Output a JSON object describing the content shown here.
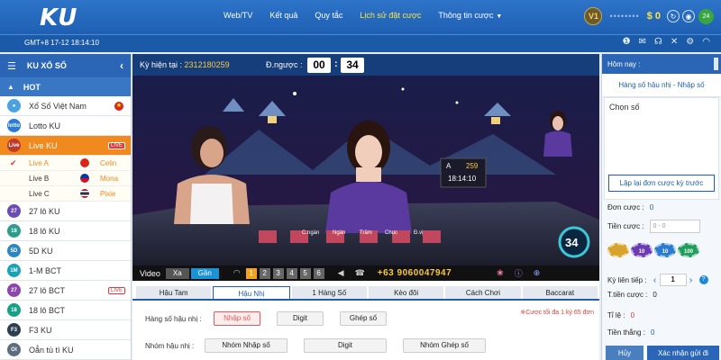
{
  "brand": {
    "logo": "KU"
  },
  "nav": [
    {
      "label": "Web/TV"
    },
    {
      "label": "Kết quả"
    },
    {
      "label": "Quy tắc"
    },
    {
      "label": "Lịch sử đặt cược"
    },
    {
      "label": "Thông tin cược"
    }
  ],
  "account": {
    "level": "V1",
    "masked": "••••••••",
    "balance": "$ 0",
    "notif_count": "24"
  },
  "clock": "GMT+8 17-12 18:14:10",
  "sidebar": {
    "title": "KU XỔ SỐ",
    "hot_label": "HOT",
    "items": [
      {
        "label": "Xổ Số Việt Nam",
        "icon_color": "#4aa3df"
      },
      {
        "label": "Lotto KU",
        "icon_color": "#2b7bd0",
        "icon_text": "lotto"
      },
      {
        "label": "Live KU",
        "tag": "LIVE",
        "icon_color": "#c0392b",
        "icon_text": "Live"
      },
      {
        "label": "27 lô KU",
        "icon_color": "#6b4bb6",
        "icon_text": "27"
      },
      {
        "label": "18 lô KU",
        "icon_color": "#2a9d8f",
        "icon_text": "18"
      },
      {
        "label": "5D KU",
        "icon_color": "#2e86c1",
        "icon_text": "5D"
      },
      {
        "label": "1-M BCT",
        "icon_color": "#17a2b8",
        "icon_text": "1M"
      },
      {
        "label": "27 lô BCT",
        "tag": "LIVE",
        "icon_color": "#8e44ad",
        "icon_text": "27"
      },
      {
        "label": "18 lô BCT",
        "icon_color": "#16a085",
        "icon_text": "18"
      },
      {
        "label": "F3 KU",
        "icon_color": "#2c3e50",
        "icon_text": "F3"
      },
      {
        "label": "Oẳn tù tì KU",
        "icon_color": "#5d6d7e",
        "icon_text": "Ot"
      }
    ],
    "sub_items": [
      {
        "label": "Live A",
        "host": "Celin"
      },
      {
        "label": "Live B",
        "host": "Mona"
      },
      {
        "label": "Live C",
        "host": "Pixie"
      }
    ]
  },
  "video_header": {
    "ky_label": "Kỳ hiện tại :",
    "ky_value": "2312180259",
    "countdown_label": "Đ.ngược :",
    "cd_min": "00",
    "cd_sep": ":",
    "cd_sec": "34"
  },
  "video": {
    "overlay_label": "A",
    "overlay_num": "259",
    "overlay_time": "18:14:10",
    "counter": "34",
    "table_labels": [
      "C.ngàn",
      "Ngàn",
      "Trăm",
      "Chục",
      "Đ.vị"
    ]
  },
  "video_bar": {
    "video_label": "Video",
    "xa": "Xa",
    "gan": "Gần",
    "channels": [
      "1",
      "2",
      "3",
      "4",
      "5",
      "6"
    ],
    "phone": "+63 9060047947"
  },
  "bet": {
    "tabs": [
      "Hậu Tam",
      "Hậu Nhị",
      "1 Hàng Số",
      "Kèo đôi",
      "Cách Chơi",
      "Baccarat"
    ],
    "note": "※Cược tối đa 1 kỳ 65 đơn",
    "row1_label": "Hàng số hậu nhị :",
    "row1_buttons": [
      "Nhập số",
      "Digit",
      "Ghép số"
    ],
    "row2_label": "Nhóm hậu nhị :",
    "row2_buttons": [
      "Nhóm Nhập số",
      "Digit",
      "Nhóm Ghép số"
    ]
  },
  "right": {
    "today": "Hôm nay :",
    "title": "Hàng số hậu nhị - Nhập số",
    "choose": "Chọn số",
    "repeat": "Lập lại đơn cược kỳ trước",
    "don_cuoc_label": "Đơn cược :",
    "don_cuoc_val": "0",
    "tien_cuoc_label": "Tiền cược :",
    "tien_cuoc_placeholder": "0 - 0",
    "chips": [
      "10",
      "10",
      "100"
    ],
    "ky_lien_tiep_label": "Kỳ liên tiếp :",
    "ky_lien_tiep_val": "1",
    "t_tien_cuoc_label": "T.tiền cược :",
    "t_tien_cuoc_val": "0",
    "ti_le_label": "Tỉ lệ :",
    "ti_le_val": "0",
    "tien_thang_label": "Tiền thắng :",
    "tien_thang_val": "0",
    "huy": "Hủy",
    "confirm": "Xác nhận gửi đi"
  }
}
